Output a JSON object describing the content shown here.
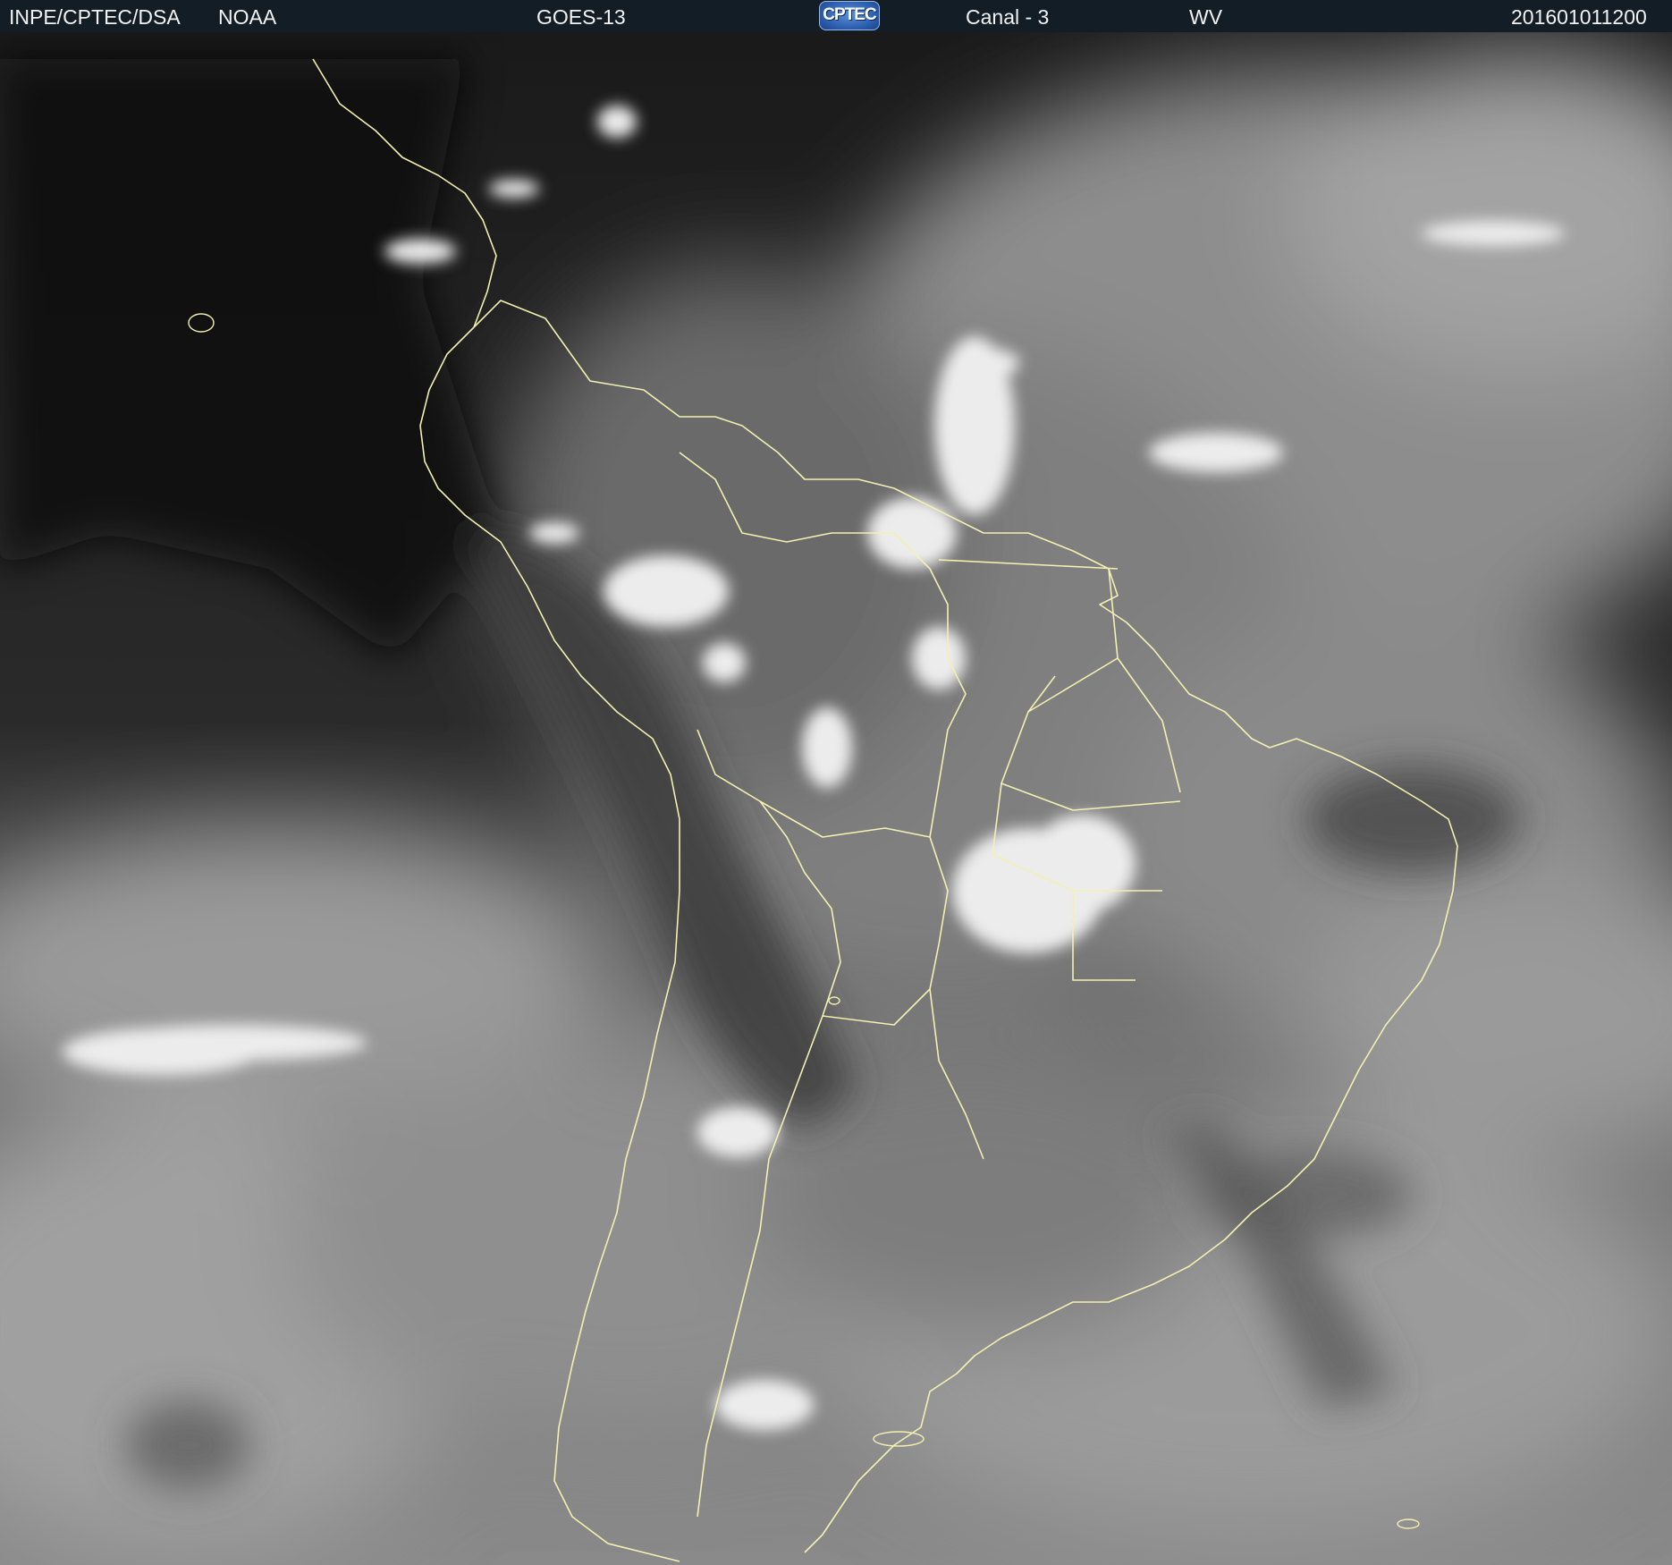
{
  "header": {
    "agency": "INPE/CPTEC/DSA",
    "source": "NOAA",
    "satellite": "GOES-13",
    "logo_text": "CPTEC",
    "channel": "Canal - 3",
    "product": "WV",
    "timestamp": "201601011200"
  },
  "colors": {
    "header_bg": "#131d26",
    "header_text": "#f2f2f2",
    "border_lines": "#f3f0b0",
    "background_dark": "#0b0b0b"
  },
  "map": {
    "type": "water-vapor satellite image",
    "region": "South America",
    "overlay": "country and state boundaries"
  }
}
